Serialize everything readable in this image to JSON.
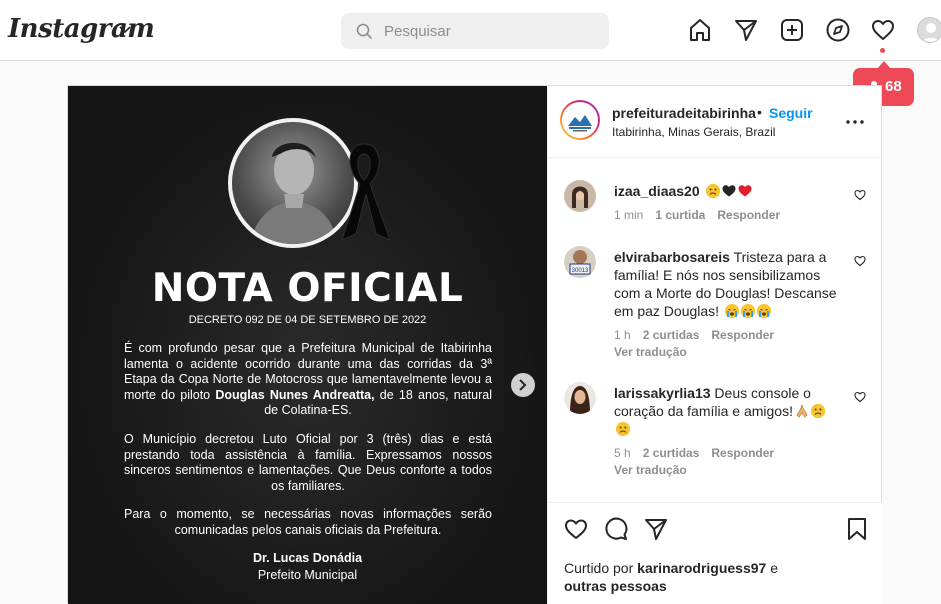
{
  "topbar": {
    "logo": "Instagram",
    "search_placeholder": "Pesquisar",
    "notifications_count": "68"
  },
  "post": {
    "account": {
      "username": "prefeituradeitabirinha",
      "separator": "•",
      "follow_label": "Seguir",
      "location": "Itabirinha, Minas Gerais, Brazil"
    },
    "image": {
      "title": "NOTA OFICIAL",
      "decreto": "DECRETO 092 DE 04 DE SETEMBRO DE 2022",
      "para1_a": "É com profundo pesar que a Prefeitura Municipal de Itabirinha lamenta o acidente ocorrido durante uma das corridas da 3ª Etapa da Copa Norte de Motocross que lamentavelmente levou a morte do piloto ",
      "para1_bold": "Douglas Nunes Andreatta,",
      "para1_b": " de 18 anos, natural de Colatina-ES.",
      "para2": "O Município decretou Luto Oficial por 3 (três) dias e está prestando toda assistência à família. Expressamos nossos sinceros sentimentos e lamentações. Que Deus conforte a todos os familiares.",
      "para3": "Para o momento, se necessárias novas informações serão comunicadas pelos canais oficiais da Prefeitura.",
      "signature_name": "Dr. Lucas Donádia",
      "signature_role": "Prefeito Municipal"
    },
    "comments": [
      {
        "username": "izaa_diaas20",
        "text": "",
        "time": "1 min",
        "likes": "1 curtida",
        "reply": "Responder",
        "translate": ""
      },
      {
        "username": "elvirabarbosareis",
        "text": "Tristeza para a família! E nós nos sensibilizamos com a Morte do Douglas! Descanse em paz Douglas!",
        "time": "1 h",
        "likes": "2 curtidas",
        "reply": "Responder",
        "translate": "Ver tradução"
      },
      {
        "username": "larissakyrlia13",
        "text": "Deus console o coração da família e amigos!",
        "time": "5 h",
        "likes": "2 curtidas",
        "reply": "Responder",
        "translate": "Ver tradução"
      }
    ],
    "liked_by": {
      "prefix": "Curtido por",
      "user": "karinarodriguess97",
      "conj": "e",
      "others": "outras pessoas"
    }
  },
  "colors": {
    "accent": "#0095f6",
    "notification": "#ed4956",
    "border": "#dbdbdb"
  }
}
